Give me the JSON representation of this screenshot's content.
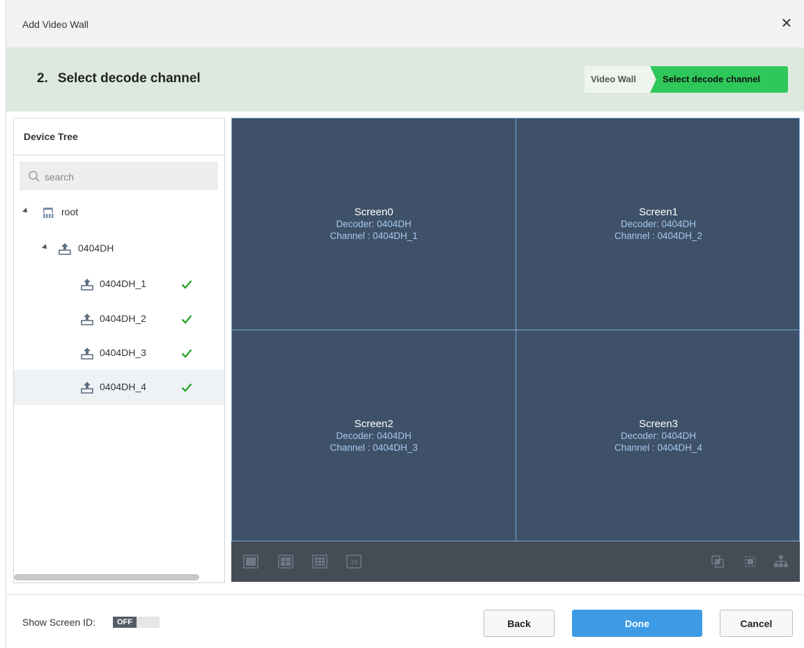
{
  "dialog": {
    "title": "Add Video Wall",
    "close_icon": "close-icon"
  },
  "step": {
    "number": "2.",
    "title": "Select decode channel",
    "breadcrumb": [
      "Video Wall",
      "Select decode channel"
    ],
    "active_color": "#2ec75a"
  },
  "tree": {
    "header": "Device Tree",
    "search_placeholder": "search",
    "root_label": "root",
    "device_label": "0404DH",
    "channels": [
      "0404DH_1",
      "0404DH_2",
      "0404DH_3",
      "0404DH_4"
    ],
    "selected_channel": "0404DH_4",
    "channel_status_icon": "check-icon",
    "check_color": "#2aa52a"
  },
  "wall": {
    "screens": [
      {
        "name": "Screen0",
        "decoder": "Decoder:  0404DH",
        "channel": "Channel : 0404DH_1"
      },
      {
        "name": "Screen1",
        "decoder": "Decoder:  0404DH",
        "channel": "Channel : 0404DH_2"
      },
      {
        "name": "Screen2",
        "decoder": "Decoder:  0404DH",
        "channel": "Channel : 0404DH_3"
      },
      {
        "name": "Screen3",
        "decoder": "Decoder:  0404DH",
        "channel": "Channel : 0404DH_4"
      }
    ],
    "layout_buttons": [
      "layout-1-icon",
      "layout-4-icon",
      "layout-9-icon",
      "layout-16-icon"
    ],
    "layout_16_label": "16",
    "tool_buttons": [
      "merge-screen-icon",
      "split-screen-icon",
      "tree-layout-icon"
    ],
    "screen_color": "#3e5168",
    "grid_line_color": "#7aa6d6"
  },
  "footer": {
    "show_screen_id_label": "Show Screen ID:",
    "toggle_state": "OFF",
    "back_label": "Back",
    "done_label": "Done",
    "cancel_label": "Cancel",
    "primary_color": "#3d9be6"
  }
}
